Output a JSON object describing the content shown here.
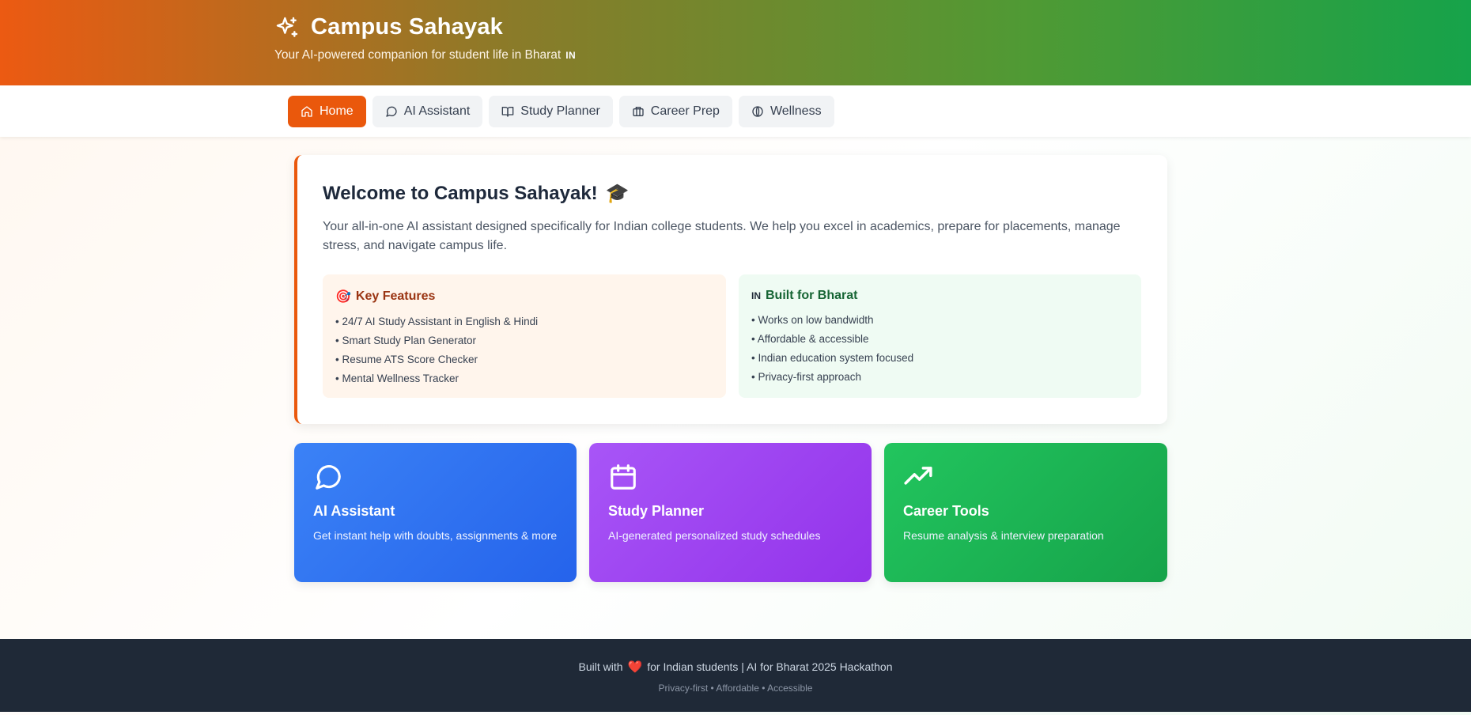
{
  "header": {
    "title": "Campus Sahayak",
    "subtitle": "Your AI-powered companion for student life in Bharat",
    "flag_badge": "IN"
  },
  "nav": {
    "tabs": [
      {
        "label": "Home",
        "icon": "home-icon",
        "active": true
      },
      {
        "label": "AI Assistant",
        "icon": "chat-icon",
        "active": false
      },
      {
        "label": "Study Planner",
        "icon": "book-icon",
        "active": false
      },
      {
        "label": "Career Prep",
        "icon": "briefcase-icon",
        "active": false
      },
      {
        "label": "Wellness",
        "icon": "wellness-icon",
        "active": false
      }
    ]
  },
  "welcome": {
    "title": "Welcome to Campus Sahayak!",
    "emoji": "🎓",
    "description": "Your all-in-one AI assistant designed specifically for Indian college students. We help you excel in academics, prepare for placements, manage stress, and navigate campus life.",
    "features": {
      "emoji": "🎯",
      "title": "Key Features",
      "items": [
        "• 24/7 AI Study Assistant in English & Hindi",
        "• Smart Study Plan Generator",
        "• Resume ATS Score Checker",
        "• Mental Wellness Tracker"
      ]
    },
    "bharat": {
      "badge": "IN",
      "title": "Built for Bharat",
      "items": [
        "• Works on low bandwidth",
        "• Affordable & accessible",
        "• Indian education system focused",
        "• Privacy-first approach"
      ]
    }
  },
  "cards": [
    {
      "title": "AI Assistant",
      "description": "Get instant help with doubts, assignments & more",
      "icon": "chat-bubble-icon"
    },
    {
      "title": "Study Planner",
      "description": "AI-generated personalized study schedules",
      "icon": "calendar-icon"
    },
    {
      "title": "Career Tools",
      "description": "Resume analysis & interview preparation",
      "icon": "trending-up-icon"
    }
  ],
  "footer": {
    "text_before": "Built with",
    "heart": "❤️",
    "text_after": "for Indian students | AI for Bharat 2025 Hackathon",
    "sub": "Privacy-first • Affordable • Accessible"
  },
  "colors": {
    "accent": "#ea580c",
    "green": "#16a34a",
    "footer_bg": "#1f2937"
  }
}
